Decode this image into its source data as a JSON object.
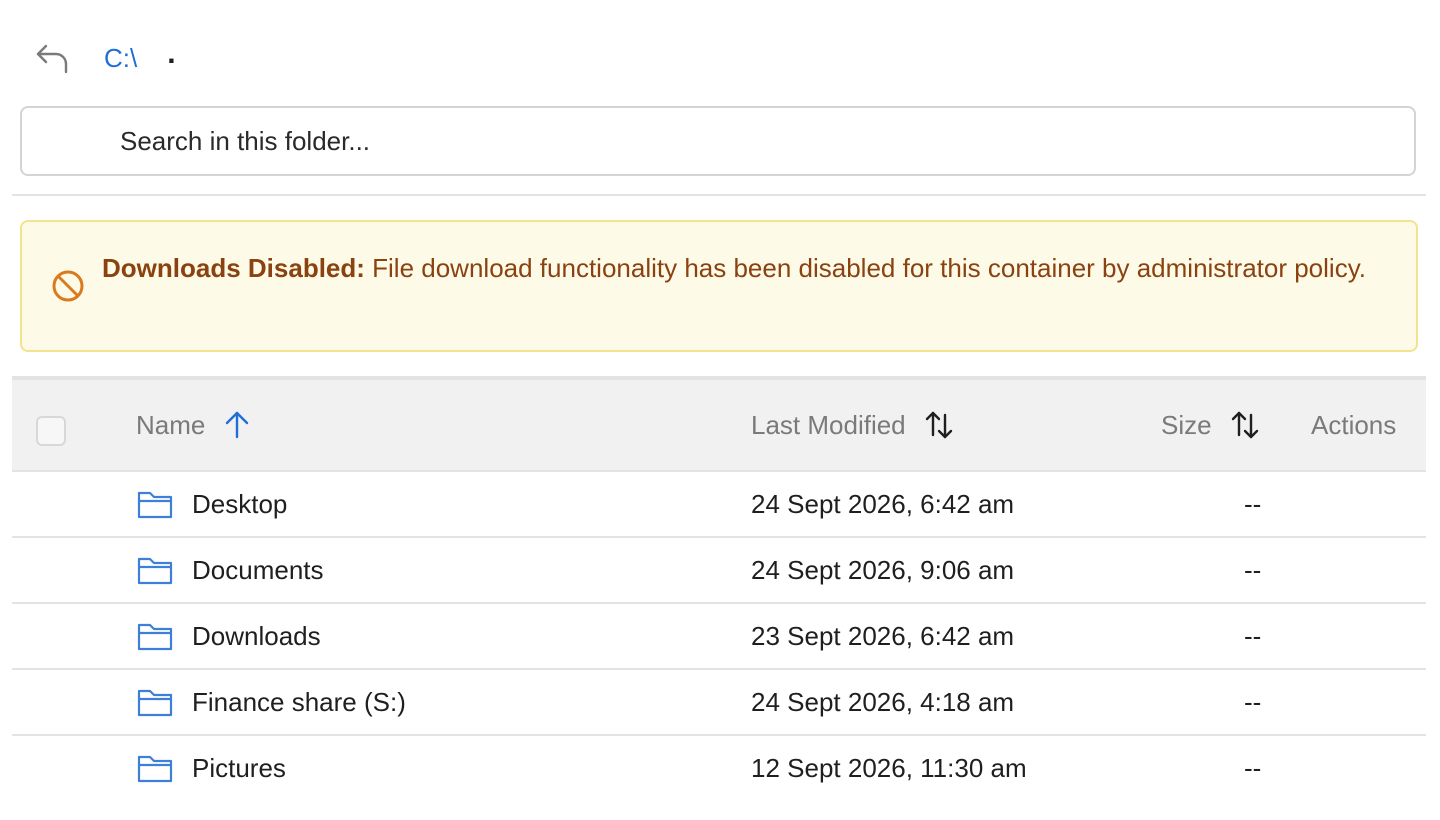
{
  "nav": {
    "back_icon": "undo-arrow-icon",
    "root_label": "C:\\",
    "separator": "."
  },
  "search": {
    "placeholder": "Search in this folder...",
    "value": ""
  },
  "alert": {
    "icon": "prohibited-icon",
    "title": "Downloads Disabled:",
    "message": " File download functionality has been disabled for this container by administrator policy.",
    "colors": {
      "background": "#fefae8",
      "border": "#f3e38e",
      "text": "#8a4210"
    }
  },
  "table": {
    "columns": {
      "name": "Name",
      "last_modified": "Last Modified",
      "size": "Size",
      "actions": "Actions"
    },
    "sort": {
      "column": "name",
      "direction": "ascending"
    },
    "rows": [
      {
        "name": "Desktop",
        "modified": "24 Sept 2026, 6:42 am",
        "size": "--",
        "icon": "folder-icon"
      },
      {
        "name": "Documents",
        "modified": "24 Sept 2026, 9:06 am",
        "size": "--",
        "icon": "folder-icon"
      },
      {
        "name": "Downloads",
        "modified": "23 Sept 2026, 6:42 am",
        "size": "--",
        "icon": "folder-icon"
      },
      {
        "name": "Finance share (S:)",
        "modified": "24 Sept 2026, 4:18 am",
        "size": "--",
        "icon": "folder-icon"
      },
      {
        "name": "Pictures",
        "modified": "12 Sept 2026, 11:30 am",
        "size": "--",
        "icon": "folder-icon"
      }
    ]
  },
  "colors": {
    "accent": "#1f6fd4",
    "folder": "#3d7fd9"
  }
}
